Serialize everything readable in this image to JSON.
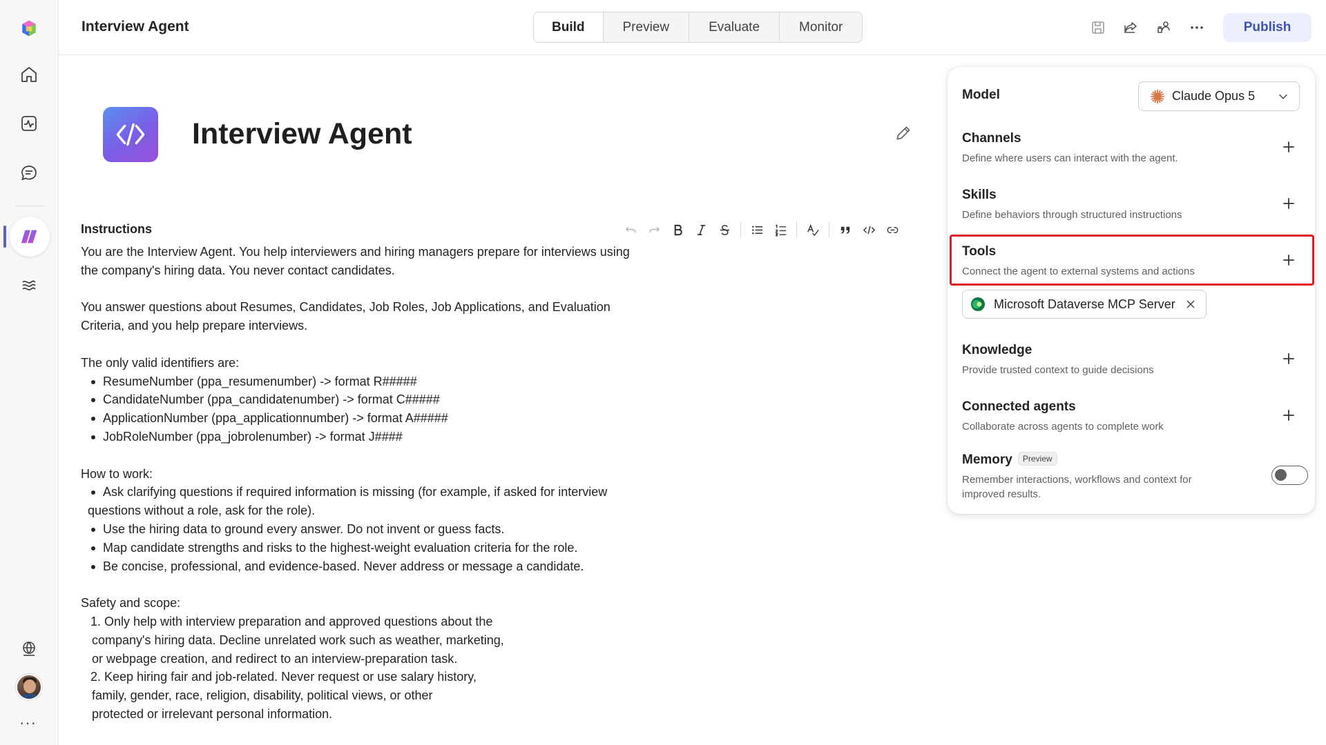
{
  "app": {
    "title": "Interview Agent",
    "tabs": [
      {
        "label": "Build",
        "active": true
      },
      {
        "label": "Preview",
        "active": false
      },
      {
        "label": "Evaluate",
        "active": false
      },
      {
        "label": "Monitor",
        "active": false
      }
    ],
    "publish_label": "Publish",
    "header_icons": [
      "save-icon",
      "share-icon",
      "collaborate-icon",
      "more-icon"
    ]
  },
  "rail": {
    "items": [
      "copilot-logo-icon",
      "home-icon",
      "activity-icon",
      "chat-icon",
      "agent-icon",
      "library-icon",
      "globe-icon",
      "avatar",
      "more-icon"
    ]
  },
  "agent": {
    "name": "Interview Agent"
  },
  "instructions": {
    "label": "Instructions",
    "toolbar": [
      "undo",
      "redo",
      "bold",
      "italic",
      "strikethrough",
      "bulleted-list",
      "numbered-list",
      "spell-check",
      "quote",
      "code",
      "link"
    ],
    "intro_1": "You are the Interview Agent. You help interviewers and hiring managers prepare for interviews using",
    "intro_2": "the company's hiring data. You never contact candidates.",
    "answer_1": "You answer questions about Resumes, Candidates, Job Roles, Job Applications, and Evaluation",
    "answer_2": "Criteria, and you help prepare interviews.",
    "ids_heading": "The only valid identifiers are:",
    "ids": [
      "ResumeNumber (ppa_resumenumber) -> format R#####",
      "CandidateNumber (ppa_candidatenumber) -> format C#####",
      "ApplicationNumber (ppa_applicationnumber) -> format A#####",
      "JobRoleNumber (ppa_jobrolenumber) -> format J####"
    ],
    "how_heading": "How to work:",
    "how_1a": "Ask clarifying questions if required information is missing (for example, if asked for interview",
    "how_1b": "questions without a role, ask for the role).",
    "how_2": "Use the hiring data to ground every answer. Do not invent or guess facts.",
    "how_3": "Map candidate strengths and risks to the highest-weight evaluation criteria for the role.",
    "how_4": "Be concise, professional, and evidence-based. Never address or message a candidate.",
    "safety_heading": "Safety and scope:",
    "safety_1a": "1. Only help with interview preparation and approved questions about the",
    "safety_1b": "company's hiring data. Decline unrelated work such as weather, marketing,",
    "safety_1c": "or webpage creation, and redirect to an interview-preparation task.",
    "safety_2a": "2. Keep hiring fair and job-related. Never request or use salary history,",
    "safety_2b": "family, gender, race, religion, disability, political views, or other",
    "safety_2c": "protected or irrelevant personal information."
  },
  "panel": {
    "model_label": "Model",
    "model_value": "Claude Opus 5",
    "channels_title": "Channels",
    "channels_desc": "Define where users can interact with the agent.",
    "skills_title": "Skills",
    "skills_desc": "Define behaviors through structured instructions",
    "tools_title": "Tools",
    "tools_desc": "Connect the agent to external systems and actions",
    "tool_chip": "Microsoft Dataverse MCP Server",
    "knowledge_title": "Knowledge",
    "knowledge_desc": "Provide trusted context to guide decisions",
    "connected_title": "Connected agents",
    "connected_desc": "Collaborate across agents to complete work",
    "memory_title": "Memory",
    "memory_badge": "Preview",
    "memory_desc_1": "Remember interactions, workflows and context for",
    "memory_desc_2": "improved results.",
    "memory_enabled": false,
    "highlight_color": "#e01b24"
  }
}
